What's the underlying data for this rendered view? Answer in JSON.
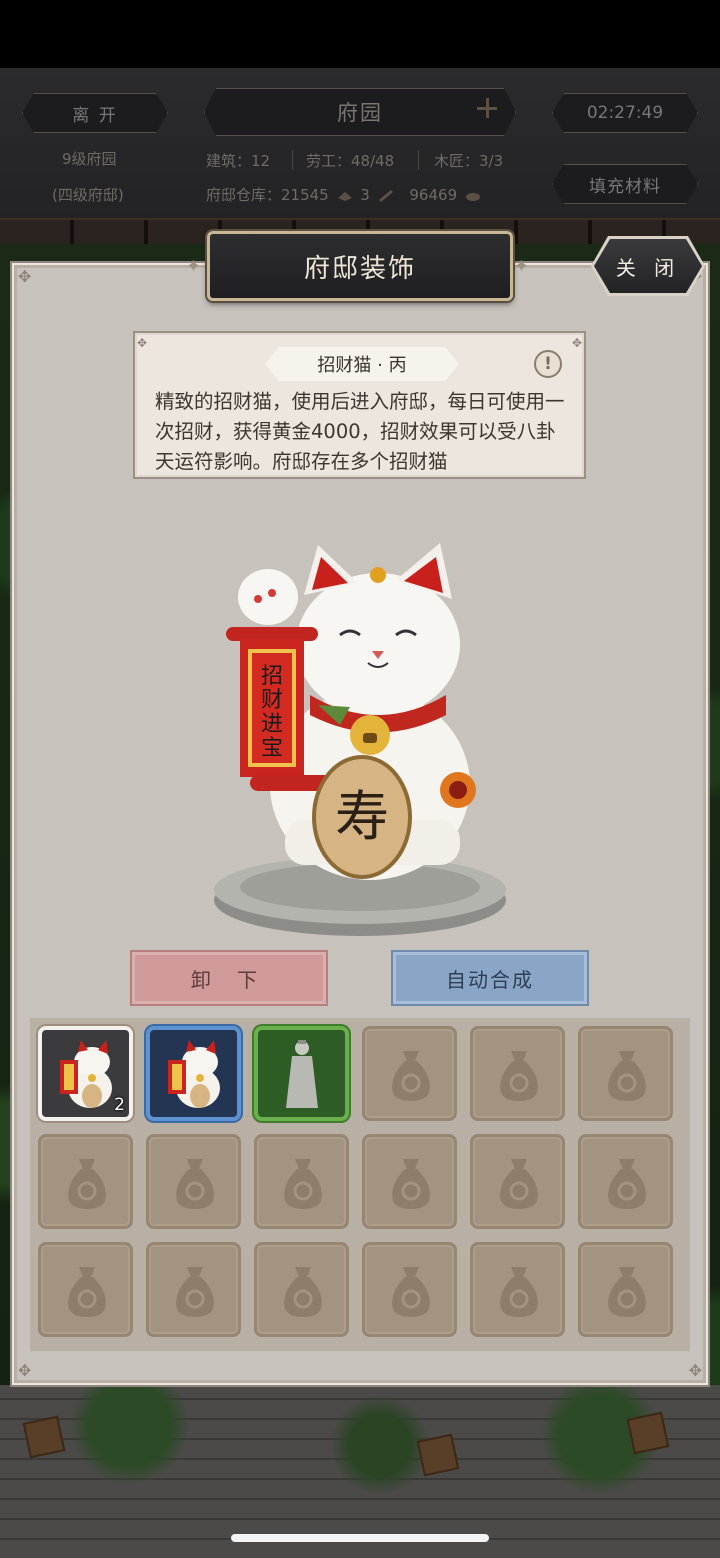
{
  "header": {
    "leave_label": "离 开",
    "location_title": "府园",
    "timer": "02:27:49",
    "level_text": "9级府园",
    "rank_text": "(四级府邸)",
    "buildings": "建筑：12",
    "workers": "劳工：48/48",
    "carpenters": "木匠：3/3",
    "storage_label": "府邸仓库：21545",
    "storage_value_2": "3",
    "storage_value_3": "96469",
    "fill_materials_label": "填充材料"
  },
  "modal": {
    "title": "府邸装饰",
    "close_label": "关 闭",
    "item": {
      "name": "招财猫 · 丙",
      "description": "精致的招财猫，使用后进入府邸，每日可使用一次招财，获得黄金4000，招财效果可以受八卦天运符影响。府邸存在多个招财猫"
    },
    "scroll_text": "招财进宝",
    "coin_text": "寿",
    "unload_label": "卸 下",
    "auto_combine_label": "自动合成"
  },
  "inventory": {
    "slots": [
      {
        "item": "lucky-cat-icon",
        "frame": "white",
        "count": "2"
      },
      {
        "item": "lucky-cat-icon",
        "frame": "blue"
      },
      {
        "item": "statue-icon",
        "frame": "green"
      },
      {
        "item": "empty-bag-icon"
      },
      {
        "item": "empty-bag-icon"
      },
      {
        "item": "empty-bag-icon"
      },
      {
        "item": "empty-bag-icon"
      },
      {
        "item": "empty-bag-icon"
      },
      {
        "item": "empty-bag-icon"
      },
      {
        "item": "empty-bag-icon"
      },
      {
        "item": "empty-bag-icon"
      },
      {
        "item": "empty-bag-icon"
      },
      {
        "item": "empty-bag-icon"
      },
      {
        "item": "empty-bag-icon"
      },
      {
        "item": "empty-bag-icon"
      },
      {
        "item": "empty-bag-icon"
      },
      {
        "item": "empty-bag-icon"
      },
      {
        "item": "empty-bag-icon"
      }
    ]
  },
  "colors": {
    "panel": "#c8c2bd",
    "unload_button": "#cf9a99",
    "auto_button": "#8aa6c7",
    "rare_blue": "#5e93d1",
    "uncommon_green": "#6ab04c"
  }
}
